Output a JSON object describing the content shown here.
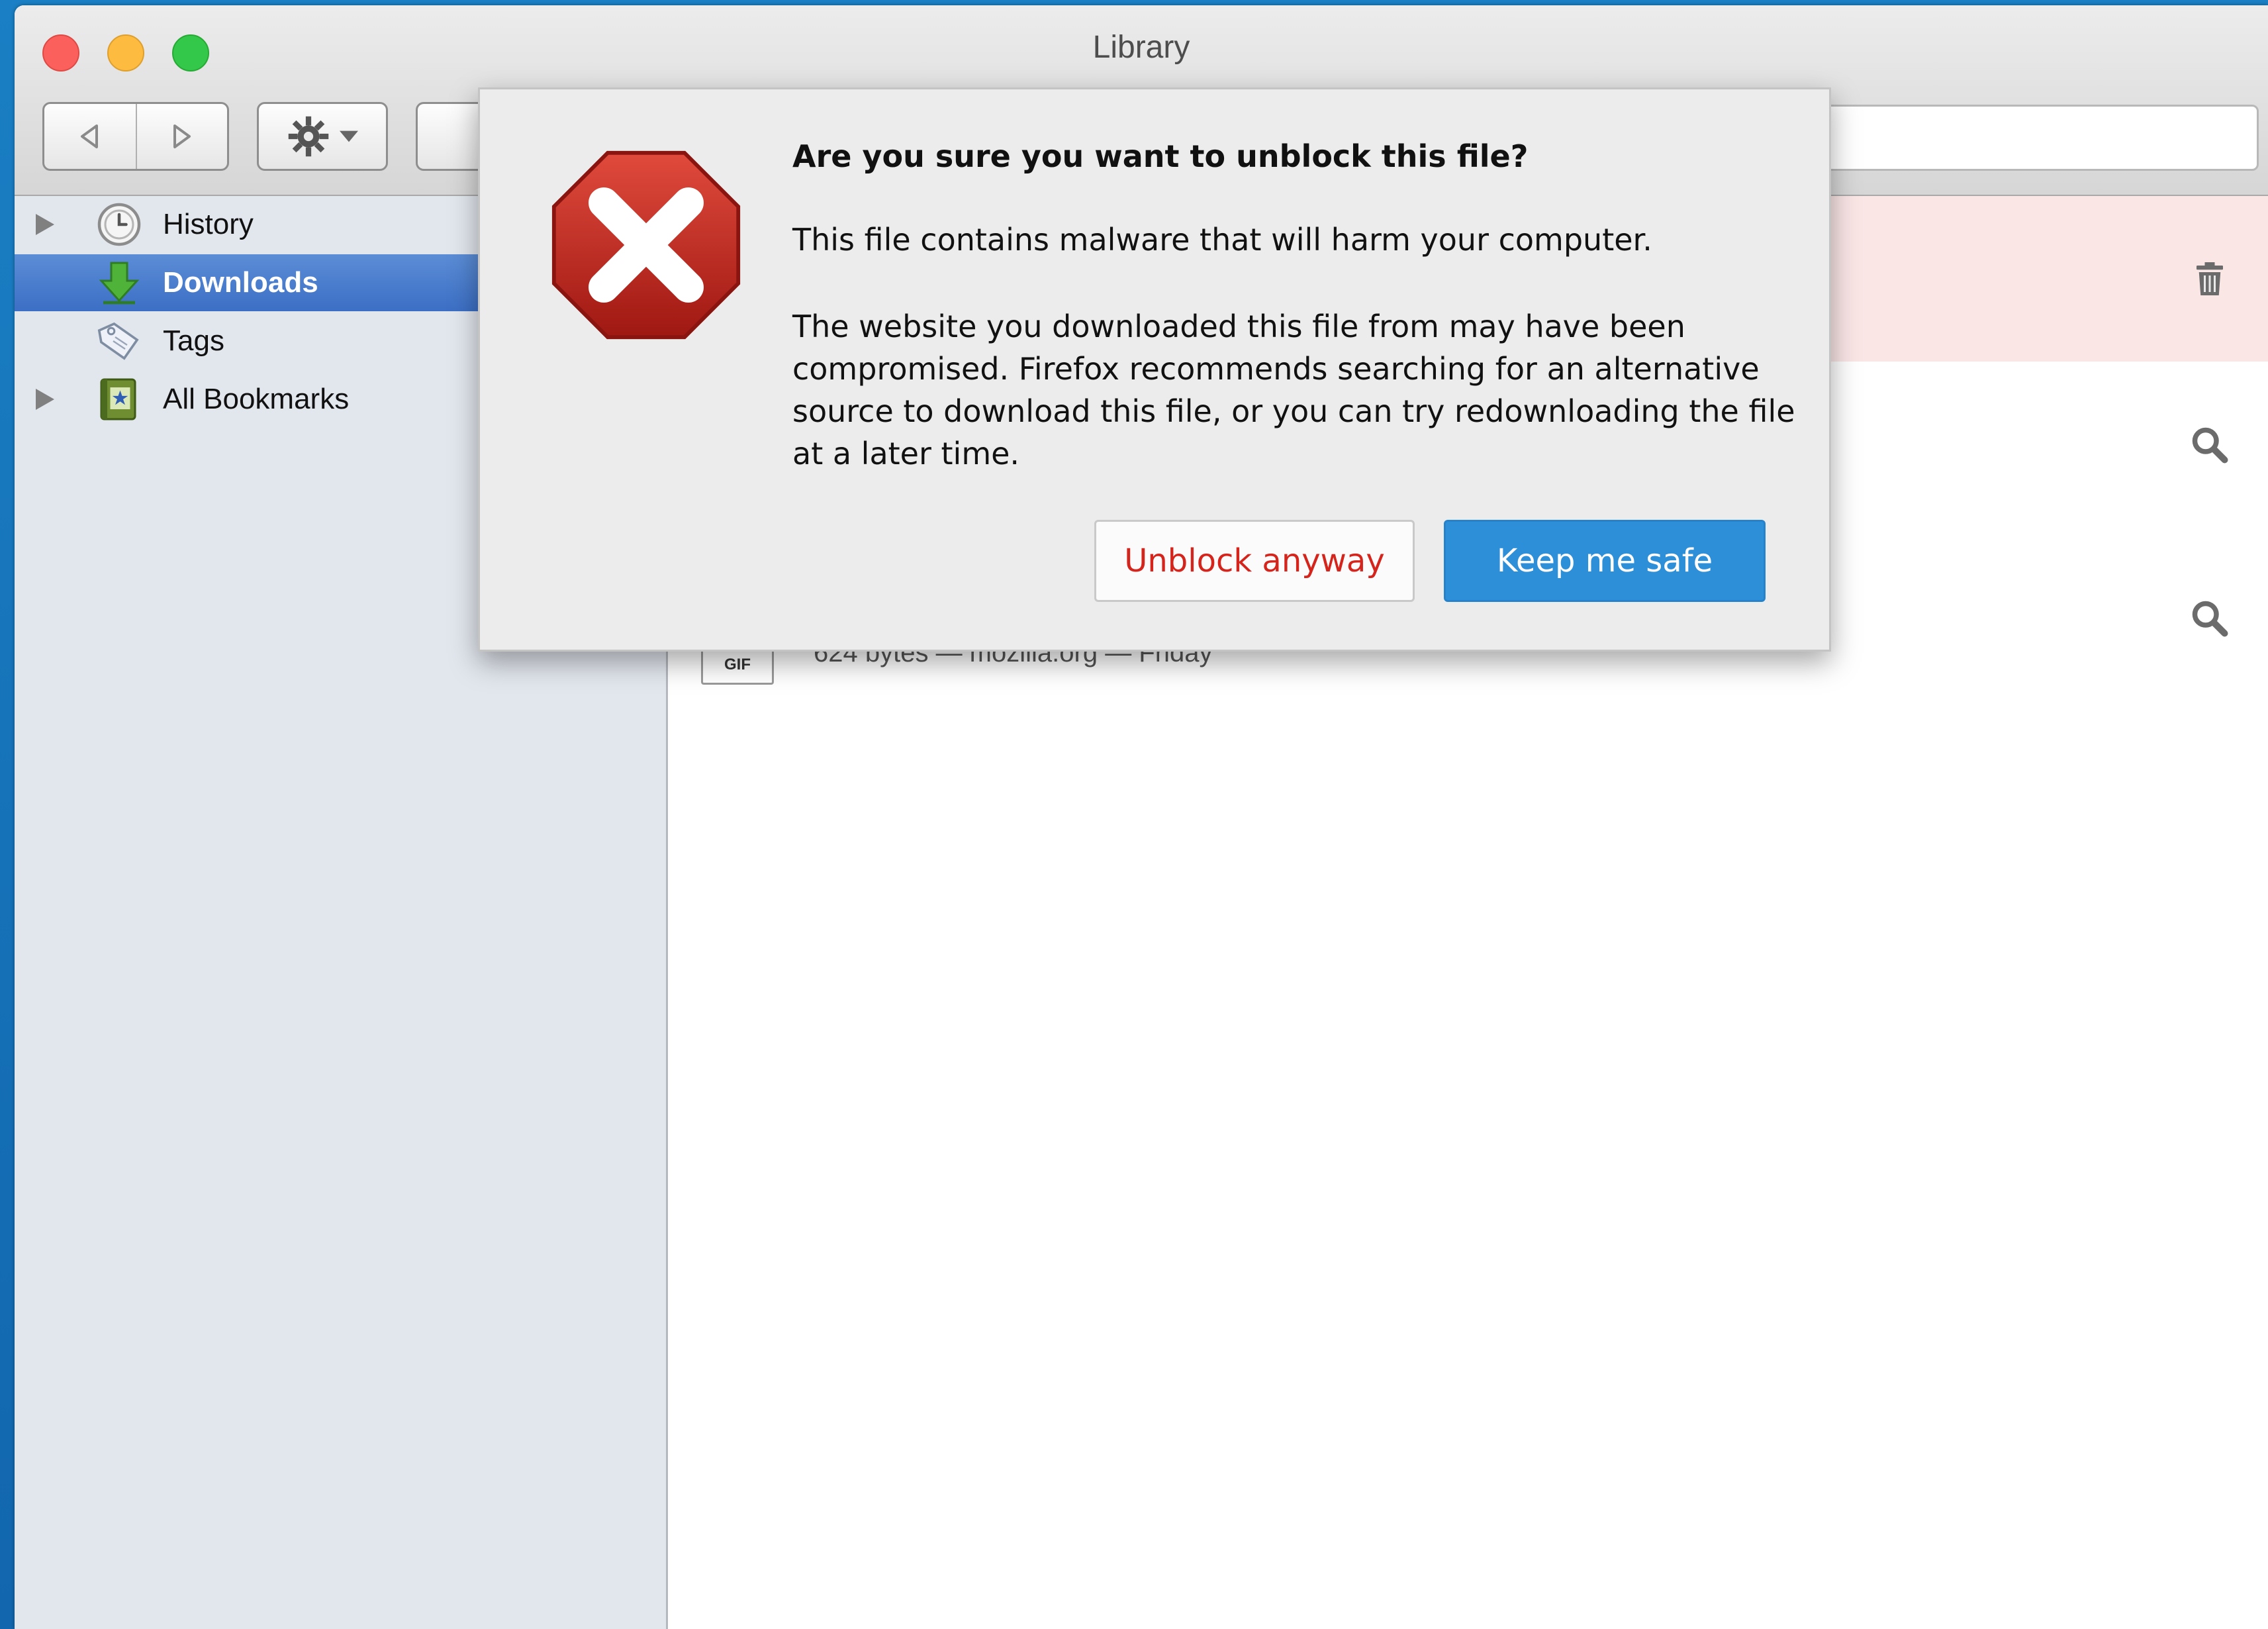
{
  "window": {
    "title": "Library"
  },
  "toolbar": {
    "back_icon": "back-arrow-icon",
    "forward_icon": "forward-arrow-icon",
    "organize_icon": "gear-icon"
  },
  "sidebar": {
    "items": [
      {
        "label": "History",
        "icon": "clock-icon",
        "expandable": true,
        "selected": false
      },
      {
        "label": "Downloads",
        "icon": "download-arrow-icon",
        "expandable": false,
        "selected": true
      },
      {
        "label": "Tags",
        "icon": "tag-icon",
        "expandable": false,
        "selected": false
      },
      {
        "label": "All Bookmarks",
        "icon": "bookmarks-book-icon",
        "expandable": true,
        "selected": false
      }
    ]
  },
  "downloads": {
    "rows": [
      {
        "status": "blocked",
        "action_icon": "trash-icon"
      },
      {
        "status": "complete",
        "action_icon": "magnifier-icon"
      },
      {
        "status": "complete",
        "action_icon": "magnifier-icon",
        "file_type": "GIF",
        "meta": "624 bytes — mozilla.org — Friday"
      }
    ]
  },
  "dialog": {
    "icon": "stop-x-icon",
    "title": "Are you sure you want to unblock this file?",
    "message": "This file contains malware that will harm your computer.",
    "detail": "The website you downloaded this file from may have been compromised. Firefox recommends searching for an alternative source to download this file, or you can try redownloading the file at a later time.",
    "buttons": {
      "unblock_label": "Unblock anyway",
      "safe_label": "Keep me safe"
    }
  },
  "colors": {
    "selection": "#3c6fc5",
    "danger": "#d4241c",
    "primary_button": "#2e8fd9",
    "blocked_row": "#fbe6e6"
  }
}
